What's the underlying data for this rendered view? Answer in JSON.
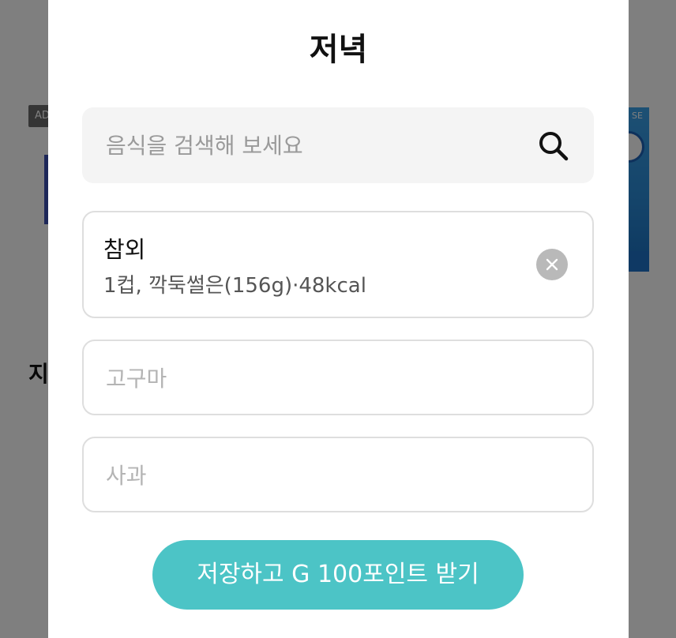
{
  "background": {
    "ad_badge": "AD",
    "right_ad_label": "SE",
    "left_heading": "지"
  },
  "modal": {
    "title": "저녁",
    "search": {
      "placeholder": "음식을 검색해 보세요",
      "value": ""
    },
    "selected_food": {
      "name": "참외",
      "detail": "1컵, 깍둑썰은(156g)·48kcal"
    },
    "inputs": [
      {
        "placeholder": "고구마",
        "value": ""
      },
      {
        "placeholder": "사과",
        "value": ""
      }
    ],
    "save_button_label": "저장하고 G 100포인트 받기"
  },
  "colors": {
    "accent": "#4cc4c6",
    "overlay": "#000000",
    "clear_button": "#b9b9b9"
  }
}
